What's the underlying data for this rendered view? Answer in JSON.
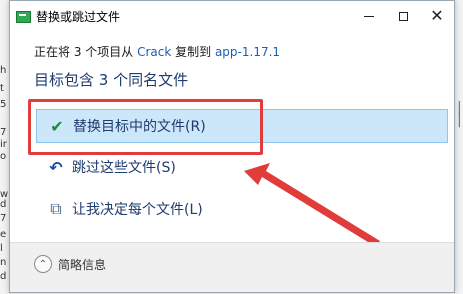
{
  "background_left_chars": [
    "h",
    "t",
    "5",
    "7",
    "ir",
    "o",
    "w",
    "d",
    "7",
    "e",
    "l",
    "n",
    "d"
  ],
  "background_right_chars": [
    "|",
    "|"
  ],
  "dialog": {
    "title": "替换或跳过文件",
    "minimize_icon": "minimize-icon",
    "maximize_icon": "maximize-icon",
    "close_symbol": "✕"
  },
  "info": {
    "prefix": "正在将 3 个项目从 ",
    "source": "Crack",
    "middle": " 复制到 ",
    "destination": "app-1.17.1"
  },
  "heading": "目标包含 3 个同名文件",
  "options": [
    {
      "icon": "✔",
      "icon_name": "checkmark-icon",
      "label": "替换目标中的文件(R)"
    },
    {
      "icon": "↶",
      "icon_name": "skip-icon",
      "label": "跳过这些文件(S)"
    },
    {
      "icon": "⧉",
      "icon_name": "decide-icon",
      "label": "让我决定每个文件(L)"
    }
  ],
  "footer": {
    "chevron": "⌃",
    "label": "简略信息"
  },
  "colors": {
    "highlight": "#e03c3c",
    "selected_bg": "#cce6fa",
    "link": "#1a5fb4",
    "heading": "#1e3b6e"
  }
}
